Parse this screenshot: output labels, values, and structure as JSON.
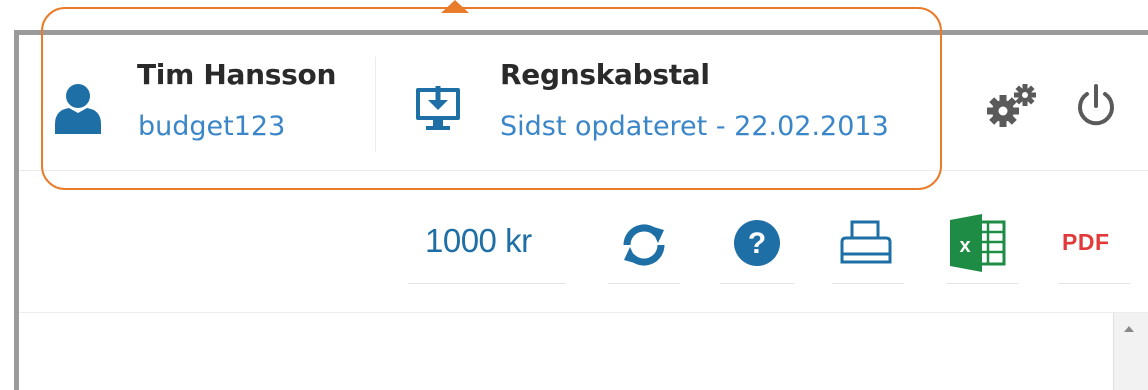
{
  "header": {
    "user": {
      "name": "Tim Hansson",
      "login": "budget123",
      "icon": "user-icon"
    },
    "accounts": {
      "title": "Regnskabstal",
      "updated": "Sidst opdateret - 22.02.2013",
      "icon": "download-monitor-icon"
    },
    "actions": {
      "settings_icon": "gears-icon",
      "power_icon": "power-icon"
    }
  },
  "toolbar": {
    "amount": "1000 kr",
    "refresh_icon": "refresh-icon",
    "help_icon": "help-icon",
    "print_icon": "printer-icon",
    "excel_icon": "excel-icon",
    "pdf_label": "PDF"
  },
  "colors": {
    "accent_blue": "#1d6fa5",
    "link_blue": "#3a86c8",
    "highlight_orange": "#e87c2a",
    "pdf_red": "#e23a3a",
    "excel_green": "#1f8c45"
  }
}
